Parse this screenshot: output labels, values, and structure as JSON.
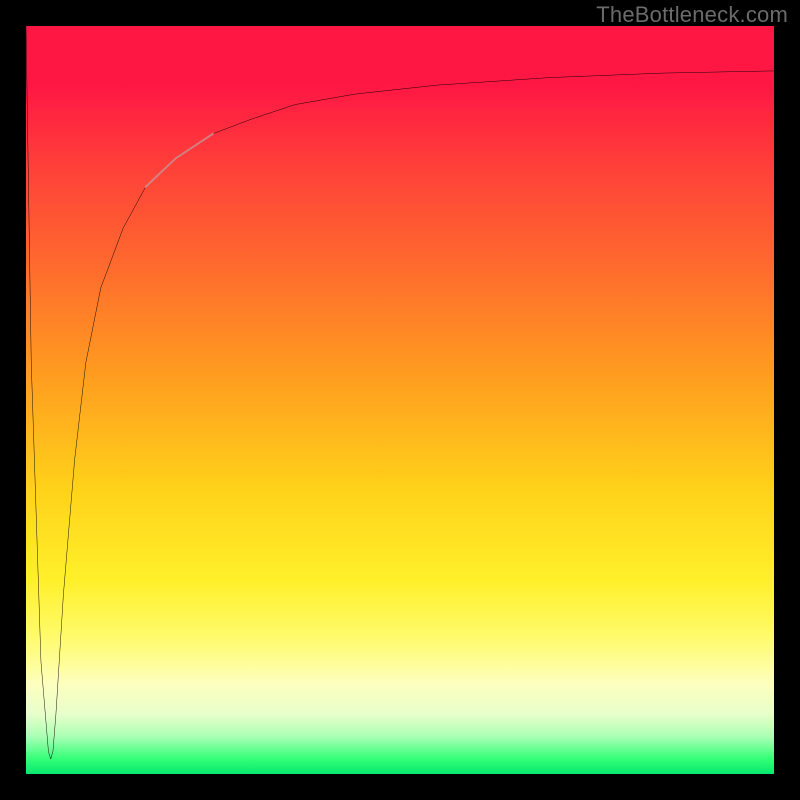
{
  "watermark": "TheBottleneck.com",
  "chart_data": {
    "type": "line",
    "title": "",
    "xlabel": "",
    "ylabel": "",
    "xlim": [
      0,
      100
    ],
    "ylim": [
      0,
      100
    ],
    "background_gradient": {
      "top": "#ff1744",
      "mid": "#ffd21a",
      "bottom": "#07e86e"
    },
    "series": [
      {
        "name": "main-curve",
        "color": "#000000",
        "x": [
          0.0,
          0.7,
          2.0,
          3.0,
          3.3,
          3.6,
          4.0,
          5.0,
          6.5,
          8.0,
          10.0,
          13.0,
          16.0,
          20.0,
          25.0,
          30.0,
          36.0,
          44.0,
          55.0,
          70.0,
          85.0,
          100.0
        ],
        "y": [
          100.0,
          55.0,
          15.0,
          3.0,
          2.0,
          3.0,
          8.0,
          24.0,
          42.0,
          55.0,
          65.0,
          73.0,
          78.5,
          82.3,
          85.6,
          87.5,
          89.5,
          90.9,
          92.1,
          93.1,
          93.7,
          94.0
        ]
      },
      {
        "name": "highlight-segment",
        "color": "rgba(210,170,170,0.85)",
        "x": [
          16.0,
          20.0,
          25.0
        ],
        "y": [
          78.5,
          82.3,
          85.6
        ]
      }
    ],
    "notes": "Axes are unitless (0–100 normalized). Curve drops sharply from top-left to a minimum near x≈3, y≈2, then rises steeply and asymptotes near y≈94 at the right edge. A short pale segment highlights the curve around x≈16–25."
  }
}
